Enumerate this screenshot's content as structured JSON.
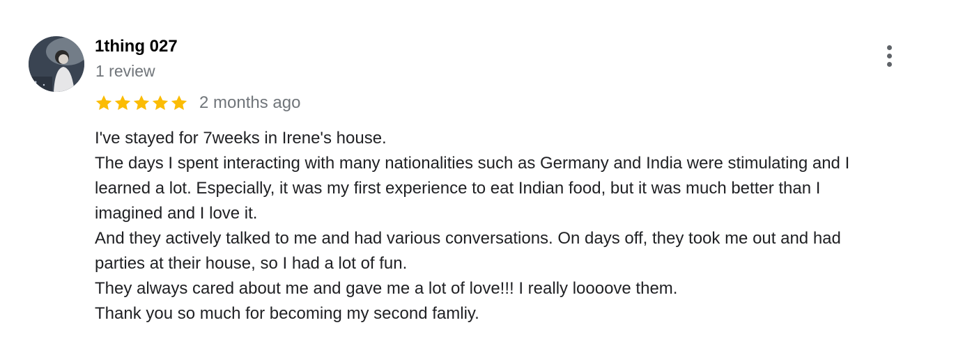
{
  "review": {
    "author": "1thing 027",
    "review_count": "1 review",
    "rating": 5,
    "rating_max": 5,
    "date": "2 months ago",
    "text_lines": [
      "I've stayed for 7weeks in Irene's house.",
      "The days I spent interacting with many nationalities such as Germany and India were stimulating and I",
      "learned a lot. Especially, it was my first experience to eat Indian food, but it was much better than I",
      "imagined and I love it.",
      "And they actively talked to me and had various conversations. On days off, they took me out and had",
      "parties at their house, so I had a lot of fun.",
      "They always cared about me and gave me a lot of love!!! I really loooove them.",
      "Thank you so much for becoming my second famliy."
    ]
  },
  "icons": {
    "star": "star-icon",
    "menu": "more-vert-icon"
  },
  "colors": {
    "star": "#fbbc04",
    "name": "#000000",
    "secondary_text": "#70757a",
    "body_text": "#202124",
    "menu_dots": "#5f6368"
  }
}
